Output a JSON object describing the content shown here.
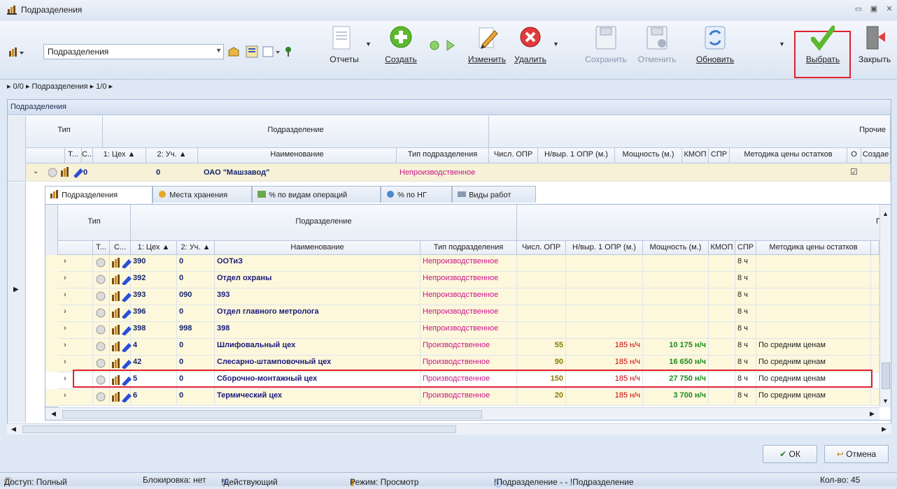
{
  "window": {
    "title": "Подразделения"
  },
  "toolbar": {
    "combo_value": "Подразделения",
    "buttons": {
      "reports": "Отчеты",
      "create": "Создать",
      "edit": "Изменить",
      "delete": "Удалить",
      "save": "Сохранить",
      "cancel": "Отменить",
      "refresh": "Обновить",
      "select": "Выбрать",
      "close": "Закрыть"
    }
  },
  "breadcrumb": {
    "a": "0/0",
    "b": "Подразделения",
    "c": "1/0"
  },
  "panel": {
    "title": "Подразделения"
  },
  "outer_grid": {
    "band_type": "Тип",
    "band_subdivision": "Подразделение",
    "band_other": "Прочие",
    "columns": [
      "Т...",
      "С...",
      "1: Цех",
      "2: Уч.",
      "Наименование",
      "Тип подразделения",
      "Числ. ОПР",
      "Н/выр. 1 ОПР (м.)",
      "Мощность (м.)",
      "КМОП",
      "СПР",
      "Методика цены остатков",
      "О",
      "Создае"
    ],
    "row": {
      "shop": "0",
      "section": "0",
      "name": "ОАО \"Машзавод\"",
      "type": "Непроизводственное",
      "o": "☑"
    }
  },
  "tabs": [
    "Подразделения",
    "Места хранения",
    "% по видам операций",
    "% по НГ",
    "Виды работ"
  ],
  "inner_grid": {
    "band_type": "Тип",
    "band_subdivision": "Подразделение",
    "band_other": "Г",
    "columns": [
      "Т...",
      "С...",
      "1: Цех",
      "2: Уч.",
      "Наименование",
      "Тип подразделения",
      "Числ. ОПР",
      "Н/выр. 1 ОПР (м.)",
      "Мощность (м.)",
      "КМОП",
      "СПР",
      "Методика цены остатков"
    ],
    "rows": [
      {
        "shop": "390",
        "section": "0",
        "name": "ООТиЗ",
        "type": "Непроизводственное",
        "count": "",
        "norm": "",
        "power": "",
        "spr": "8 ч",
        "method": ""
      },
      {
        "shop": "392",
        "section": "0",
        "name": "Отдел охраны",
        "type": "Непроизводственное",
        "count": "",
        "norm": "",
        "power": "",
        "spr": "8 ч",
        "method": ""
      },
      {
        "shop": "393",
        "section": "090",
        "name": "393",
        "type": "Непроизводственное",
        "count": "",
        "norm": "",
        "power": "",
        "spr": "8 ч",
        "method": ""
      },
      {
        "shop": "396",
        "section": "0",
        "name": "Отдел главного метролога",
        "type": "Непроизводственное",
        "count": "",
        "norm": "",
        "power": "",
        "spr": "8 ч",
        "method": ""
      },
      {
        "shop": "398",
        "section": "998",
        "name": "398",
        "type": "Непроизводственное",
        "count": "",
        "norm": "",
        "power": "",
        "spr": "8 ч",
        "method": ""
      },
      {
        "shop": "4",
        "section": "0",
        "name": "Шлифовальный цех",
        "type": "Производственное",
        "count": "55",
        "norm": "185 н/ч",
        "power": "10 175 н/ч",
        "spr": "8 ч",
        "method": "По средним ценам"
      },
      {
        "shop": "42",
        "section": "0",
        "name": "Слесарно-штамповочный цех",
        "type": "Производственное",
        "count": "90",
        "norm": "185 н/ч",
        "power": "16 650 н/ч",
        "spr": "8 ч",
        "method": "По средним ценам"
      },
      {
        "shop": "5",
        "section": "0",
        "name": "Сборочно-монтажный цех",
        "type": "Производственное",
        "count": "150",
        "norm": "185 н/ч",
        "power": "27 750 н/ч",
        "spr": "8 ч",
        "method": "По средним ценам"
      },
      {
        "shop": "6",
        "section": "0",
        "name": "Термический цех",
        "type": "Производственное",
        "count": "20",
        "norm": "185 н/ч",
        "power": "3 700 н/ч",
        "spr": "8 ч",
        "method": "По средним ценам"
      }
    ]
  },
  "dialog": {
    "ok": "ОК",
    "cancel": "Отмена"
  },
  "status": {
    "access": "Доступ: Полный",
    "lock": "Блокировка: нет",
    "state": "!Действующий",
    "mode": "Режим: Просмотр",
    "info": "!Подразделение - - !Подразделение",
    "count": "Кол-во: 45"
  },
  "colors": {
    "highlight": "#e0202e",
    "row_bg": "#fdf8dc",
    "link": "#c71585"
  }
}
